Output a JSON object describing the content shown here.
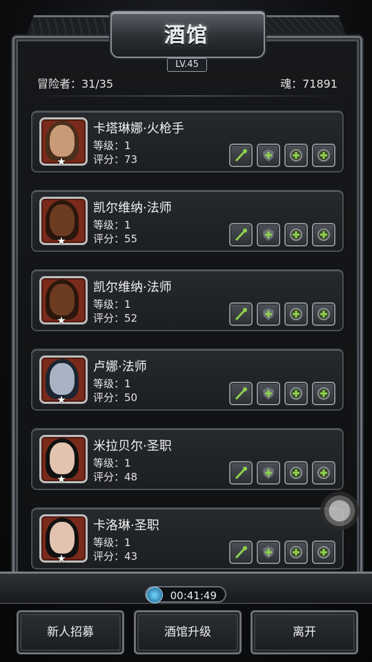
{
  "title": "酒馆",
  "level": "LV.45",
  "adventurers": "冒险者：31/35",
  "soul": "魂：71891",
  "heroes": [
    {
      "name": "卡塔琳娜·火枪手",
      "level": "等级：1",
      "score": "评分：73",
      "portrait": "musketeer-portrait"
    },
    {
      "name": "凯尔维纳·法师",
      "level": "等级：1",
      "score": "评分：55",
      "portrait": "mage-portrait"
    },
    {
      "name": "凯尔维纳·法师",
      "level": "等级：1",
      "score": "评分：52",
      "portrait": "mage-portrait"
    },
    {
      "name": "卢娜·法师",
      "level": "等级：1",
      "score": "评分：50",
      "portrait": "hooded-mage-portrait"
    },
    {
      "name": "米拉贝尔·圣职",
      "level": "等级：1",
      "score": "评分：48",
      "portrait": "priestess-portrait"
    },
    {
      "name": "卡洛琳·圣职",
      "level": "等级：1",
      "score": "评分：43",
      "portrait": "priestess-portrait"
    }
  ],
  "skill_slots": [
    "skill-staff-icon",
    "skill-shield-icon",
    "skill-orb-icon",
    "skill-orb-icon"
  ],
  "timer": "00:41:49",
  "buttons": {
    "recruit": "新人招募",
    "upgrade": "酒馆升级",
    "leave": "离开"
  },
  "colors": {
    "accent_green": "#8fd14f",
    "portrait_bg": "#7a2a1a",
    "frame": "#6e737a"
  }
}
